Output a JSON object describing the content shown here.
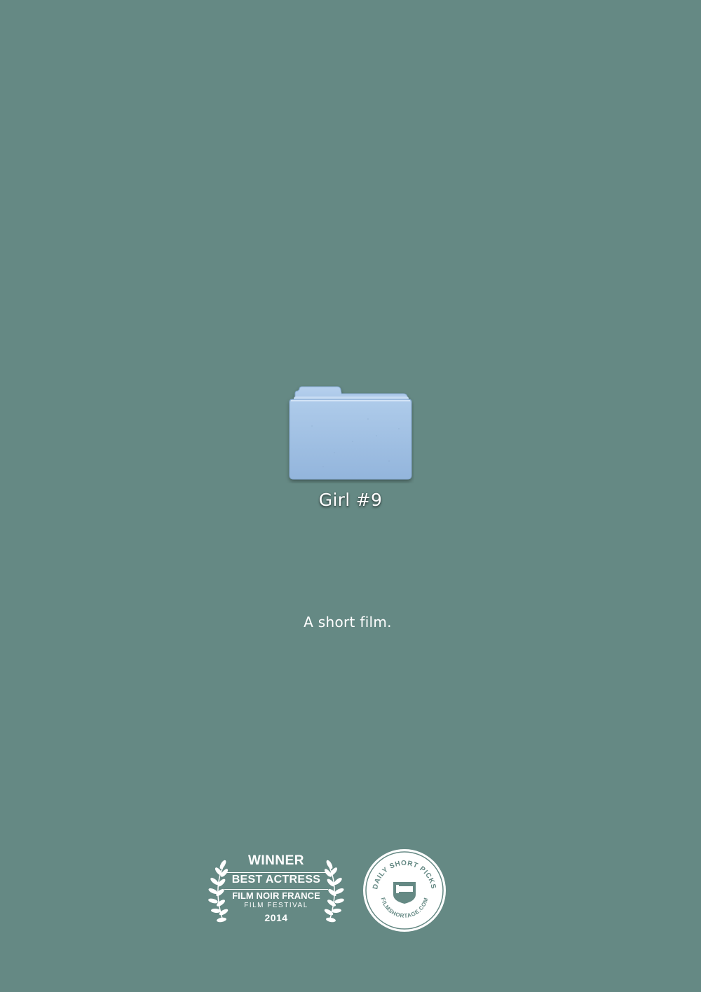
{
  "poster": {
    "background_color": "#658984",
    "folder": {
      "icon": "folder-icon",
      "color": "#a9c6e8",
      "label": "Girl #9"
    },
    "tagline": "A short film."
  },
  "laurel": {
    "icon": "laurel-wreath-icon",
    "winner": "WINNER",
    "award": "BEST ACTRESS",
    "festival": "FILM NOIR FRANCE",
    "festival_sub": "FILM FESTIVAL",
    "year": "2014"
  },
  "seal": {
    "icon": "film-shortage-seal-icon",
    "top_text": "DAILY SHORT PICKS",
    "bottom_text": "FILMSHORTAGE.COM"
  }
}
